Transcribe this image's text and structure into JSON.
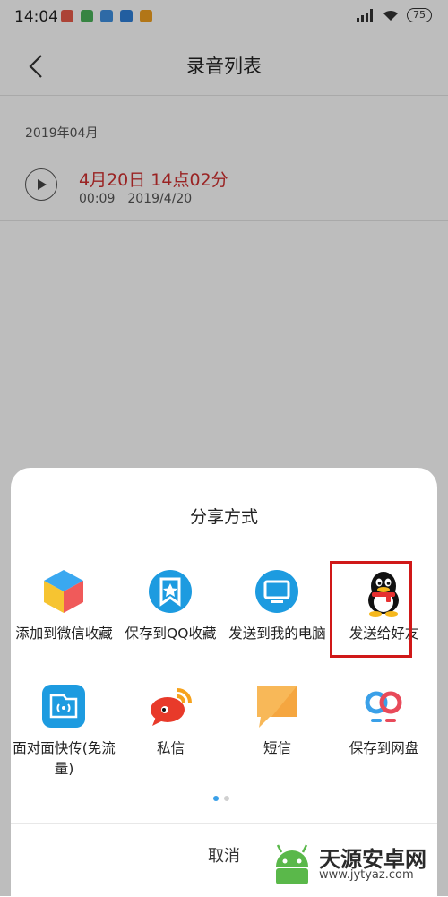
{
  "status_bar": {
    "time": "14:04",
    "battery": "75",
    "app_icons": [
      "message-app-icon",
      "maps-app-icon",
      "browser-app-icon",
      "pin-app-icon",
      "weibo-app-icon"
    ]
  },
  "header": {
    "title": "录音列表"
  },
  "recordings": {
    "month": "2019年04月",
    "items": [
      {
        "name": "4月20日 14点02分",
        "duration": "00:09",
        "date": "2019/4/20"
      }
    ]
  },
  "share_sheet": {
    "title": "分享方式",
    "items": [
      {
        "label": "添加到微信收藏",
        "icon": "wechat-favorites-icon"
      },
      {
        "label": "保存到QQ收藏",
        "icon": "qq-favorites-icon"
      },
      {
        "label": "发送到我的电脑",
        "icon": "my-computer-icon"
      },
      {
        "label": "发送给好友",
        "icon": "qq-penguin-icon",
        "highlighted": true
      },
      {
        "label": "面对面快传(免流量)",
        "icon": "face-to-face-transfer-icon"
      },
      {
        "label": "私信",
        "icon": "private-message-icon"
      },
      {
        "label": "短信",
        "icon": "sms-icon"
      },
      {
        "label": "保存到网盘",
        "icon": "cloud-drive-icon"
      }
    ],
    "page_count": 2,
    "current_page": 1,
    "cancel": "取消"
  },
  "watermark": {
    "text": "天源安卓网",
    "url": "www.jytyaz.com"
  },
  "colors": {
    "accent_red": "#d03030",
    "highlight_red": "#d01818",
    "dot_active": "#3aa0e8"
  }
}
